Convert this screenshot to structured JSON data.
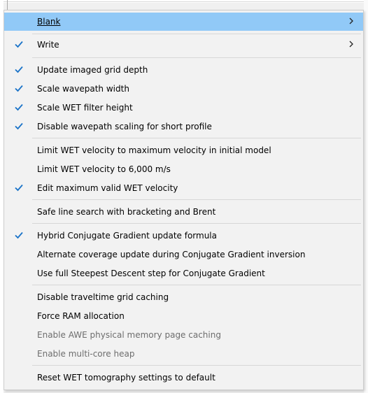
{
  "menu": {
    "items": [
      {
        "label": "Blank",
        "has_submenu": true,
        "checked": false,
        "enabled": true,
        "highlighted": true
      },
      {
        "label": "Write",
        "has_submenu": true,
        "checked": true,
        "enabled": true
      },
      {
        "label": "Update imaged grid depth",
        "checked": true,
        "enabled": true
      },
      {
        "label": "Scale wavepath width",
        "checked": true,
        "enabled": true
      },
      {
        "label": "Scale WET filter height",
        "checked": true,
        "enabled": true
      },
      {
        "label": "Disable wavepath scaling for short profile",
        "checked": true,
        "enabled": true
      },
      {
        "label": "Limit WET velocity to maximum velocity in initial model",
        "checked": false,
        "enabled": true
      },
      {
        "label": "Limit WET velocity to 6,000 m/s",
        "checked": false,
        "enabled": true
      },
      {
        "label": "Edit maximum valid WET velocity",
        "checked": true,
        "enabled": true
      },
      {
        "label": "Safe line search with bracketing and Brent",
        "checked": false,
        "enabled": true
      },
      {
        "label": "Hybrid Conjugate Gradient update formula",
        "checked": true,
        "enabled": true
      },
      {
        "label": "Alternate coverage update during Conjugate Gradient inversion",
        "checked": false,
        "enabled": true
      },
      {
        "label": "Use full Steepest Descent step for Conjugate Gradient",
        "checked": false,
        "enabled": true
      },
      {
        "label": "Disable traveltime grid caching",
        "checked": false,
        "enabled": true
      },
      {
        "label": "Force RAM allocation",
        "checked": false,
        "enabled": true
      },
      {
        "label": "Enable AWE physical memory page caching",
        "checked": false,
        "enabled": false
      },
      {
        "label": "Enable multi-core heap",
        "checked": false,
        "enabled": false
      },
      {
        "label": "Reset WET tomography settings to default",
        "checked": false,
        "enabled": true
      }
    ],
    "icons": {
      "check": "check-icon",
      "submenu": "chevron-right-icon"
    },
    "colors": {
      "highlight": "#91c9f7",
      "check": "#1a73c8",
      "disabled_text": "#6d6d6d"
    }
  }
}
